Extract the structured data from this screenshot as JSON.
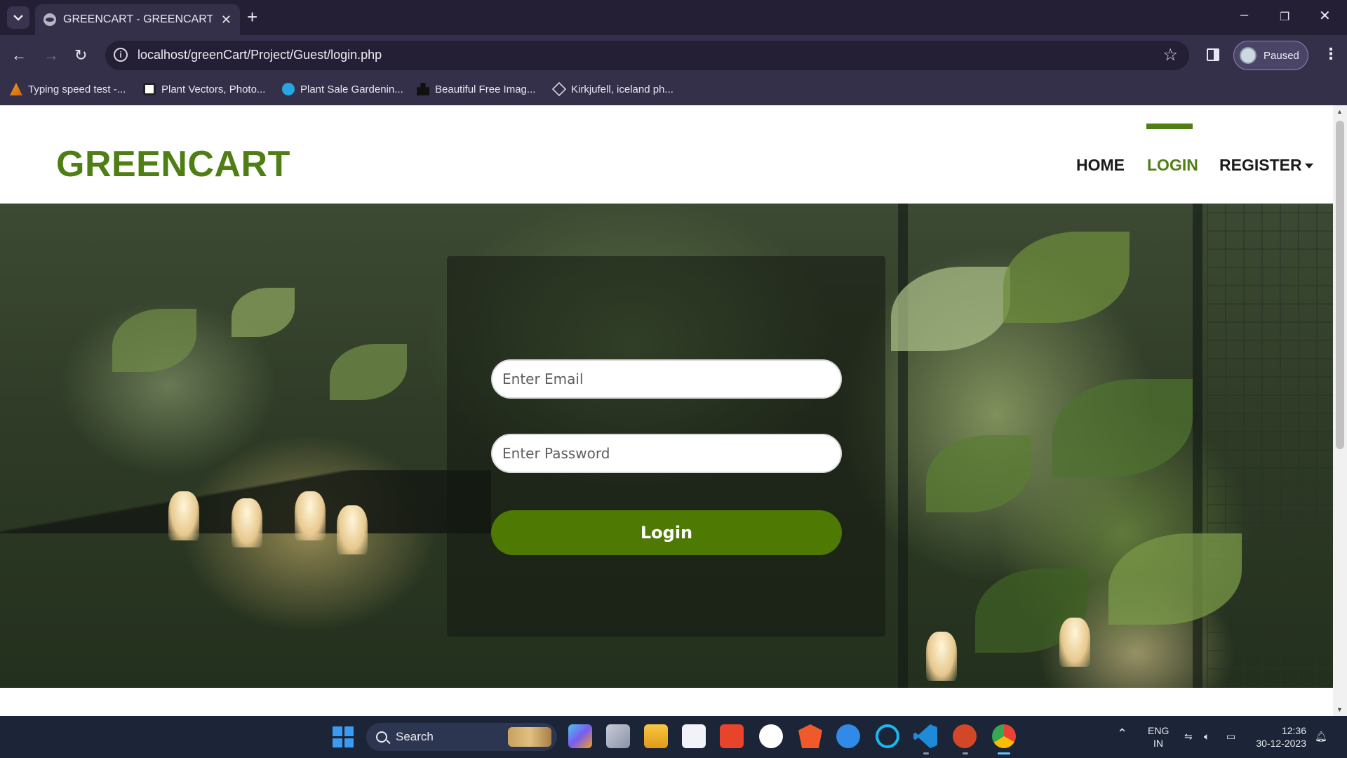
{
  "browser": {
    "tab_title": "GREENCART - GREENCART Login",
    "url": "localhost/greenCart/Project/Guest/login.php",
    "profile_label": "Paused",
    "bookmarks": [
      {
        "label": "Typing speed test -...",
        "icon": "typing-test-icon"
      },
      {
        "label": "Plant Vectors, Photo...",
        "icon": "freepik-icon"
      },
      {
        "label": "Plant Sale Gardenin...",
        "icon": "search-site-icon"
      },
      {
        "label": "Beautiful Free Imag...",
        "icon": "unsplash-icon"
      },
      {
        "label": "Kirkjufell, iceland ph...",
        "icon": "cube-icon"
      }
    ]
  },
  "site": {
    "logo": "GREENCART",
    "nav": {
      "home": "HOME",
      "login": "LOGIN",
      "register": "REGISTER"
    },
    "accent_color": "#4e7e14"
  },
  "login_form": {
    "email_placeholder": "Enter Email",
    "password_placeholder": "Enter Password",
    "submit_label": "Login",
    "button_color": "#4e7a03"
  },
  "taskbar": {
    "search_label": "Search",
    "lang_line1": "ENG",
    "lang_line2": "IN",
    "time": "12:36",
    "date": "30-12-2023"
  }
}
